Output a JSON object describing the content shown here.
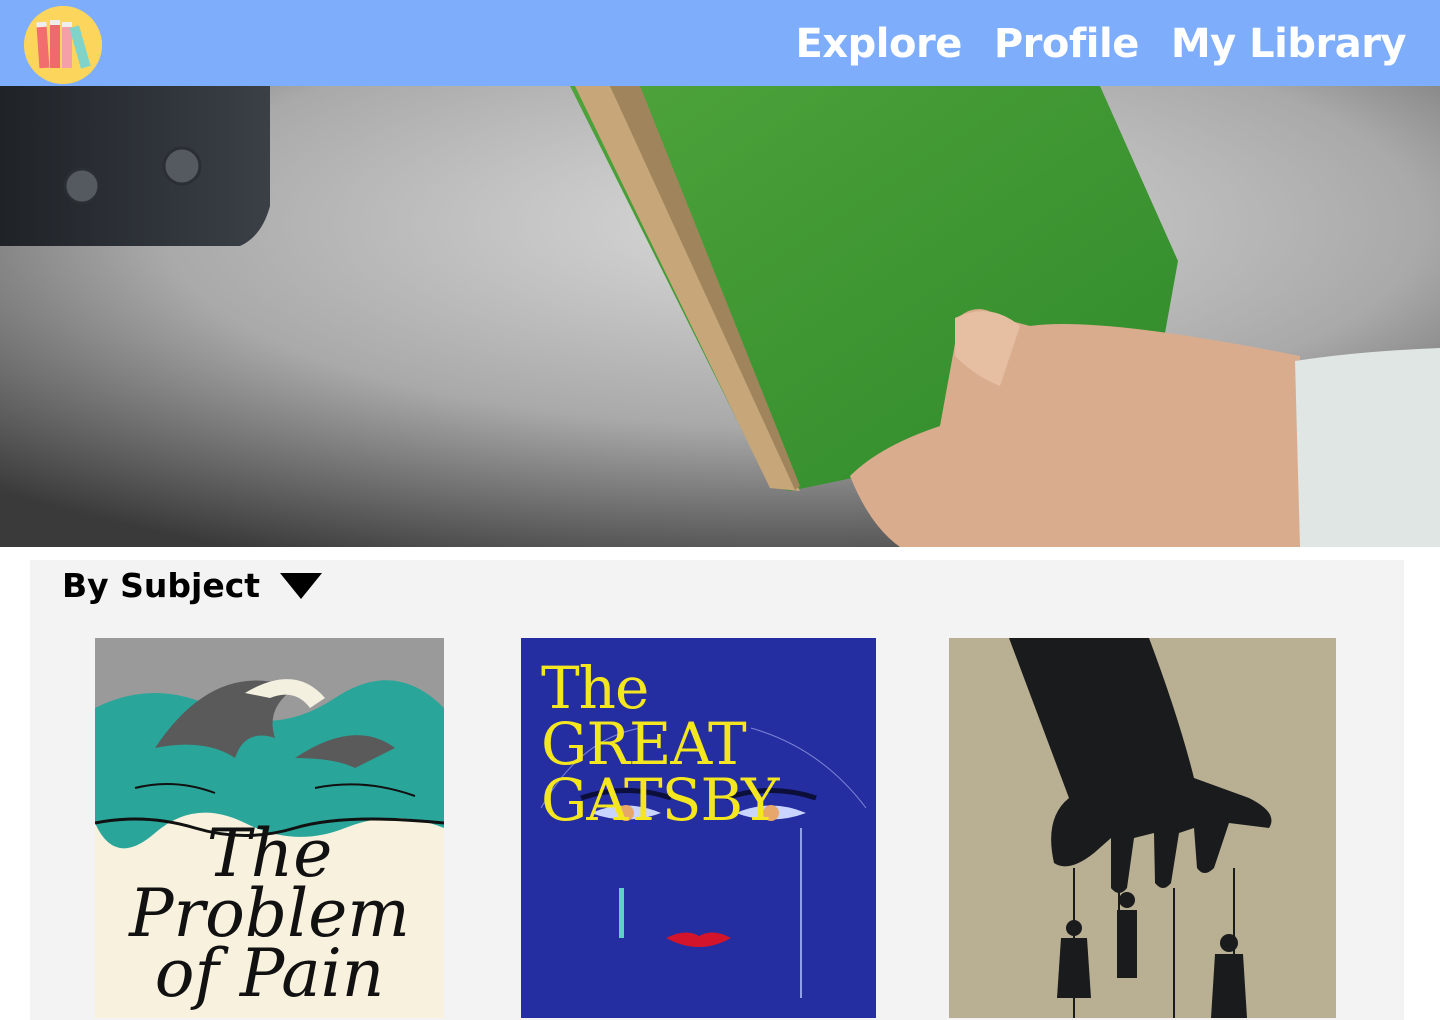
{
  "header": {
    "nav": {
      "explore": "Explore",
      "profile": "Profile",
      "library": "My Library"
    },
    "bar_color": "#7eaefb",
    "logo_icon": "books-icon"
  },
  "hero": {
    "image": "hands-passing-green-book"
  },
  "browse": {
    "filter_label": "By Subject",
    "books": [
      {
        "cover_title": "The Problem of Pain",
        "cover_art": "great-wave"
      },
      {
        "cover_title": "The GREAT GATSBY",
        "cover_art": "celestial-eyes"
      },
      {
        "cover_title": "",
        "cover_art": "hand-with-puppets"
      }
    ]
  }
}
